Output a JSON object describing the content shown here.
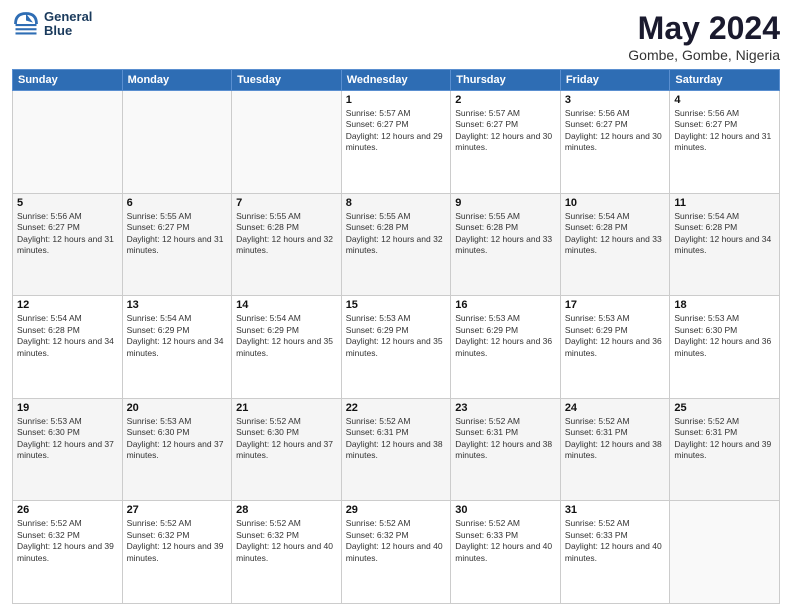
{
  "header": {
    "logo_line1": "General",
    "logo_line2": "Blue",
    "title": "May 2024",
    "subtitle": "Gombe, Gombe, Nigeria"
  },
  "days_of_week": [
    "Sunday",
    "Monday",
    "Tuesday",
    "Wednesday",
    "Thursday",
    "Friday",
    "Saturday"
  ],
  "weeks": [
    [
      {
        "day": "",
        "sunrise": "",
        "sunset": "",
        "daylight": ""
      },
      {
        "day": "",
        "sunrise": "",
        "sunset": "",
        "daylight": ""
      },
      {
        "day": "",
        "sunrise": "",
        "sunset": "",
        "daylight": ""
      },
      {
        "day": "1",
        "sunrise": "Sunrise: 5:57 AM",
        "sunset": "Sunset: 6:27 PM",
        "daylight": "Daylight: 12 hours and 29 minutes."
      },
      {
        "day": "2",
        "sunrise": "Sunrise: 5:57 AM",
        "sunset": "Sunset: 6:27 PM",
        "daylight": "Daylight: 12 hours and 30 minutes."
      },
      {
        "day": "3",
        "sunrise": "Sunrise: 5:56 AM",
        "sunset": "Sunset: 6:27 PM",
        "daylight": "Daylight: 12 hours and 30 minutes."
      },
      {
        "day": "4",
        "sunrise": "Sunrise: 5:56 AM",
        "sunset": "Sunset: 6:27 PM",
        "daylight": "Daylight: 12 hours and 31 minutes."
      }
    ],
    [
      {
        "day": "5",
        "sunrise": "Sunrise: 5:56 AM",
        "sunset": "Sunset: 6:27 PM",
        "daylight": "Daylight: 12 hours and 31 minutes."
      },
      {
        "day": "6",
        "sunrise": "Sunrise: 5:55 AM",
        "sunset": "Sunset: 6:27 PM",
        "daylight": "Daylight: 12 hours and 31 minutes."
      },
      {
        "day": "7",
        "sunrise": "Sunrise: 5:55 AM",
        "sunset": "Sunset: 6:28 PM",
        "daylight": "Daylight: 12 hours and 32 minutes."
      },
      {
        "day": "8",
        "sunrise": "Sunrise: 5:55 AM",
        "sunset": "Sunset: 6:28 PM",
        "daylight": "Daylight: 12 hours and 32 minutes."
      },
      {
        "day": "9",
        "sunrise": "Sunrise: 5:55 AM",
        "sunset": "Sunset: 6:28 PM",
        "daylight": "Daylight: 12 hours and 33 minutes."
      },
      {
        "day": "10",
        "sunrise": "Sunrise: 5:54 AM",
        "sunset": "Sunset: 6:28 PM",
        "daylight": "Daylight: 12 hours and 33 minutes."
      },
      {
        "day": "11",
        "sunrise": "Sunrise: 5:54 AM",
        "sunset": "Sunset: 6:28 PM",
        "daylight": "Daylight: 12 hours and 34 minutes."
      }
    ],
    [
      {
        "day": "12",
        "sunrise": "Sunrise: 5:54 AM",
        "sunset": "Sunset: 6:28 PM",
        "daylight": "Daylight: 12 hours and 34 minutes."
      },
      {
        "day": "13",
        "sunrise": "Sunrise: 5:54 AM",
        "sunset": "Sunset: 6:29 PM",
        "daylight": "Daylight: 12 hours and 34 minutes."
      },
      {
        "day": "14",
        "sunrise": "Sunrise: 5:54 AM",
        "sunset": "Sunset: 6:29 PM",
        "daylight": "Daylight: 12 hours and 35 minutes."
      },
      {
        "day": "15",
        "sunrise": "Sunrise: 5:53 AM",
        "sunset": "Sunset: 6:29 PM",
        "daylight": "Daylight: 12 hours and 35 minutes."
      },
      {
        "day": "16",
        "sunrise": "Sunrise: 5:53 AM",
        "sunset": "Sunset: 6:29 PM",
        "daylight": "Daylight: 12 hours and 36 minutes."
      },
      {
        "day": "17",
        "sunrise": "Sunrise: 5:53 AM",
        "sunset": "Sunset: 6:29 PM",
        "daylight": "Daylight: 12 hours and 36 minutes."
      },
      {
        "day": "18",
        "sunrise": "Sunrise: 5:53 AM",
        "sunset": "Sunset: 6:30 PM",
        "daylight": "Daylight: 12 hours and 36 minutes."
      }
    ],
    [
      {
        "day": "19",
        "sunrise": "Sunrise: 5:53 AM",
        "sunset": "Sunset: 6:30 PM",
        "daylight": "Daylight: 12 hours and 37 minutes."
      },
      {
        "day": "20",
        "sunrise": "Sunrise: 5:53 AM",
        "sunset": "Sunset: 6:30 PM",
        "daylight": "Daylight: 12 hours and 37 minutes."
      },
      {
        "day": "21",
        "sunrise": "Sunrise: 5:52 AM",
        "sunset": "Sunset: 6:30 PM",
        "daylight": "Daylight: 12 hours and 37 minutes."
      },
      {
        "day": "22",
        "sunrise": "Sunrise: 5:52 AM",
        "sunset": "Sunset: 6:31 PM",
        "daylight": "Daylight: 12 hours and 38 minutes."
      },
      {
        "day": "23",
        "sunrise": "Sunrise: 5:52 AM",
        "sunset": "Sunset: 6:31 PM",
        "daylight": "Daylight: 12 hours and 38 minutes."
      },
      {
        "day": "24",
        "sunrise": "Sunrise: 5:52 AM",
        "sunset": "Sunset: 6:31 PM",
        "daylight": "Daylight: 12 hours and 38 minutes."
      },
      {
        "day": "25",
        "sunrise": "Sunrise: 5:52 AM",
        "sunset": "Sunset: 6:31 PM",
        "daylight": "Daylight: 12 hours and 39 minutes."
      }
    ],
    [
      {
        "day": "26",
        "sunrise": "Sunrise: 5:52 AM",
        "sunset": "Sunset: 6:32 PM",
        "daylight": "Daylight: 12 hours and 39 minutes."
      },
      {
        "day": "27",
        "sunrise": "Sunrise: 5:52 AM",
        "sunset": "Sunset: 6:32 PM",
        "daylight": "Daylight: 12 hours and 39 minutes."
      },
      {
        "day": "28",
        "sunrise": "Sunrise: 5:52 AM",
        "sunset": "Sunset: 6:32 PM",
        "daylight": "Daylight: 12 hours and 40 minutes."
      },
      {
        "day": "29",
        "sunrise": "Sunrise: 5:52 AM",
        "sunset": "Sunset: 6:32 PM",
        "daylight": "Daylight: 12 hours and 40 minutes."
      },
      {
        "day": "30",
        "sunrise": "Sunrise: 5:52 AM",
        "sunset": "Sunset: 6:33 PM",
        "daylight": "Daylight: 12 hours and 40 minutes."
      },
      {
        "day": "31",
        "sunrise": "Sunrise: 5:52 AM",
        "sunset": "Sunset: 6:33 PM",
        "daylight": "Daylight: 12 hours and 40 minutes."
      },
      {
        "day": "",
        "sunrise": "",
        "sunset": "",
        "daylight": ""
      }
    ]
  ]
}
